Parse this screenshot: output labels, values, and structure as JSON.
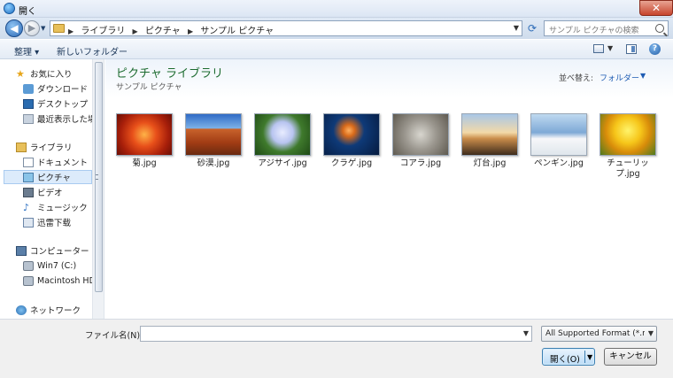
{
  "window": {
    "title": "開く",
    "close_glyph": "✕"
  },
  "nav_buttons": {
    "back_glyph": "◀",
    "forward_glyph": "▶",
    "history_glyph": "▼"
  },
  "address": {
    "crumbs": [
      "ライブラリ",
      "ピクチャ",
      "サンプル ピクチャ"
    ],
    "separator": "▶",
    "dropdown_glyph": "▼",
    "refresh_glyph": "⟳"
  },
  "search": {
    "placeholder": "サンプル ピクチャの検索"
  },
  "toolbar": {
    "organize": "整理 ▾",
    "new_folder": "新しいフォルダー",
    "views_drop": "▼",
    "help": "?"
  },
  "nav": {
    "items": [
      {
        "label": "お気に入り",
        "icon": "star-icon"
      },
      {
        "label": "ダウンロード",
        "icon": "download-folder-icon"
      },
      {
        "label": "デスクトップ",
        "icon": "desktop-icon"
      },
      {
        "label": "最近表示した場所",
        "icon": "recent-places-icon"
      },
      {
        "label": "ライブラリ",
        "icon": "library-icon"
      },
      {
        "label": "ドキュメント",
        "icon": "documents-icon"
      },
      {
        "label": "ピクチャ",
        "icon": "pictures-icon"
      },
      {
        "label": "ビデオ",
        "icon": "videos-icon"
      },
      {
        "label": "ミュージック",
        "icon": "music-icon"
      },
      {
        "label": "迅雷下载",
        "icon": "xunlei-download-icon"
      },
      {
        "label": "コンピューター",
        "icon": "computer-icon"
      },
      {
        "label": "Win7 (C:)",
        "icon": "drive-icon"
      },
      {
        "label": "Macintosh HD (I",
        "icon": "drive-icon"
      },
      {
        "label": "ネットワーク",
        "icon": "network-icon"
      }
    ],
    "selected": "ピクチャ",
    "music_glyph": "♪",
    "star_glyph": "★"
  },
  "content": {
    "library_title": "ピクチャ ライブラリ",
    "library_subtitle": "サンプル ピクチャ",
    "arrange_label": "並べ替え:",
    "arrange_value": "フォルダー",
    "arrange_drop": "▼",
    "files": [
      {
        "name": "菊.jpg",
        "thumb": "chrysanthemum"
      },
      {
        "name": "砂漠.jpg",
        "thumb": "desert"
      },
      {
        "name": "アジサイ.jpg",
        "thumb": "hydrangeas"
      },
      {
        "name": "クラゲ.jpg",
        "thumb": "jellyfish"
      },
      {
        "name": "コアラ.jpg",
        "thumb": "koala"
      },
      {
        "name": "灯台.jpg",
        "thumb": "lighthouse"
      },
      {
        "name": "ペンギン.jpg",
        "thumb": "penguins"
      },
      {
        "name": "チューリップ.jpg",
        "thumb": "tulips"
      }
    ]
  },
  "bottom": {
    "filename_label": "ファイル名(N):",
    "filename_value": "",
    "filename_drop": "▼",
    "filter_value": "All Supported Format (*.mp",
    "filter_drop": "▼",
    "open_label": "開く(O)",
    "open_drop": "▼",
    "cancel_label": "キャンセル"
  }
}
